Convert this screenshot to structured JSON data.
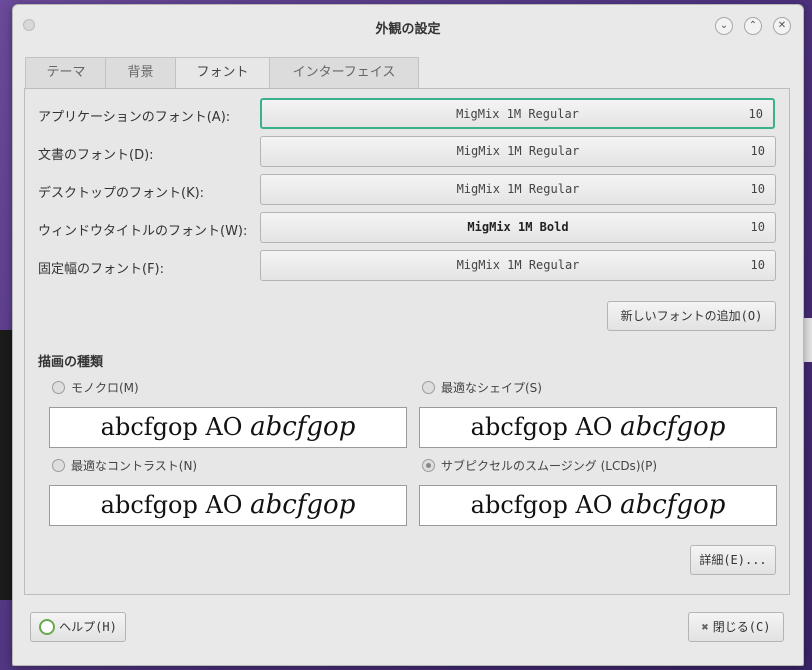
{
  "window": {
    "title": "外観の設定",
    "controls": [
      "minimize",
      "maximize",
      "close"
    ]
  },
  "tabs": [
    {
      "label": "テーマ",
      "active": false
    },
    {
      "label": "背景",
      "active": false
    },
    {
      "label": "フォント",
      "active": true
    },
    {
      "label": "インターフェイス",
      "active": false
    }
  ],
  "font_rows": [
    {
      "label": "アプリケーションのフォント(A):",
      "font": "MigMix 1M Regular",
      "size": "10"
    },
    {
      "label": "文書のフォント(D):",
      "font": "MigMix 1M Regular",
      "size": "10"
    },
    {
      "label": "デスクトップのフォント(K):",
      "font": "MigMix 1M Regular",
      "size": "10"
    },
    {
      "label": "ウィンドウタイトルのフォント(W):",
      "font": "MigMix 1M Bold",
      "size": "10"
    },
    {
      "label": "固定幅のフォント(F):",
      "font": "MigMix 1M Regular",
      "size": "10"
    }
  ],
  "add_font_button": "新しいフォントの追加(O)",
  "rendering": {
    "title": "描画の種類",
    "options": [
      {
        "label": "モノクロ(M)",
        "checked": false,
        "preview_regular": "abcfgop AO ",
        "preview_italic": "abcfgop"
      },
      {
        "label": "最適なシェイプ(S)",
        "checked": false,
        "preview_regular": "abcfgop AO ",
        "preview_italic": "abcfgop"
      },
      {
        "label": "最適なコントラスト(N)",
        "checked": false,
        "preview_regular": "abcfgop AO ",
        "preview_italic": "abcfgop"
      },
      {
        "label": "サブピクセルのスムージング (LCDs)(P)",
        "checked": true,
        "preview_regular": "abcfgop AO ",
        "preview_italic": "abcfgop"
      }
    ]
  },
  "details_button": "詳細(E)...",
  "help_button": "ヘルプ(H)",
  "close_button": "閉じる(C)",
  "colors": {
    "focus_accent": "#3bb08f",
    "desktop_bg": "#5a3a8a"
  }
}
